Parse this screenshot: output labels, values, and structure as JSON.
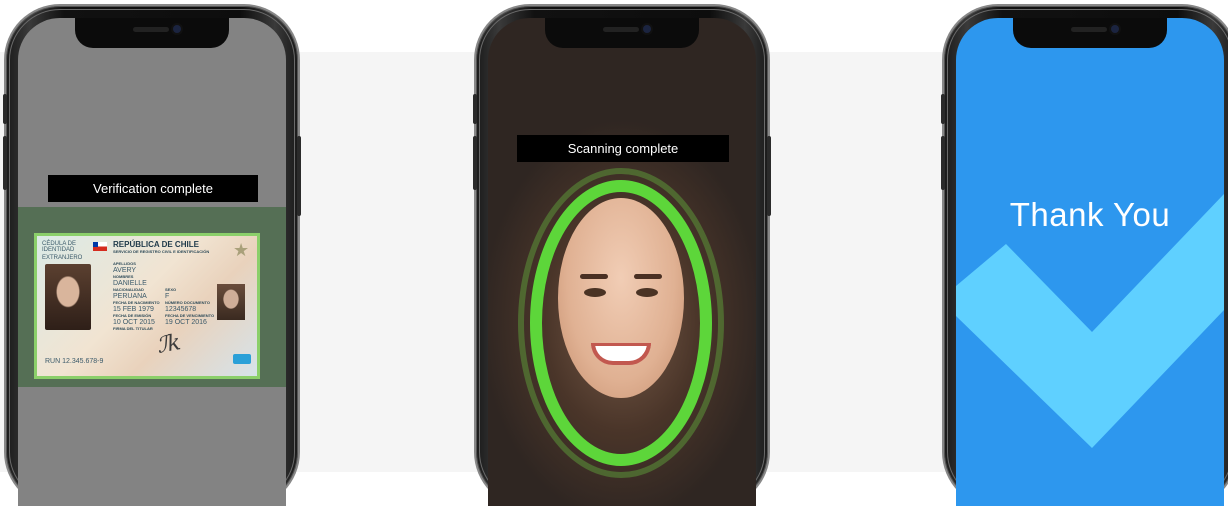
{
  "phone1": {
    "banner": "Verification complete",
    "card": {
      "doc_type": "CÉDULA DE IDENTIDAD",
      "country": "REPÚBLICA DE CHILE",
      "agency": "SERVICIO DE REGISTRO CIVIL E IDENTIFICACIÓN",
      "category": "EXTRANJERO",
      "surname_label": "APELLIDOS",
      "surname": "AVERY",
      "names_label": "NOMBRES",
      "names": "DANIELLE",
      "nationality_label": "NACIONALIDAD",
      "nationality": "PERUANA",
      "sex_label": "SEXO",
      "sex": "F",
      "birth_label": "FECHA DE NACIMIENTO",
      "birth": "15 FEB 1979",
      "docnum_label": "NÚMERO DOCUMENTO",
      "docnum": "12345678",
      "issue_label": "FECHA DE EMISIÓN",
      "issue": "10 OCT 2015",
      "expiry_label": "FECHA DE VENCIMIENTO",
      "expiry": "19 OCT 2016",
      "signature_label": "FIRMA DEL TITULAR",
      "run": "RUN 12.345.678-9"
    }
  },
  "phone2": {
    "banner": "Scanning complete"
  },
  "phone3": {
    "title": "Thank You"
  },
  "colors": {
    "page_band": "#f5f5f5",
    "scan_ring": "#5dd63a",
    "thanks_bg": "#2d97ee",
    "check": "#5fd0ff"
  }
}
